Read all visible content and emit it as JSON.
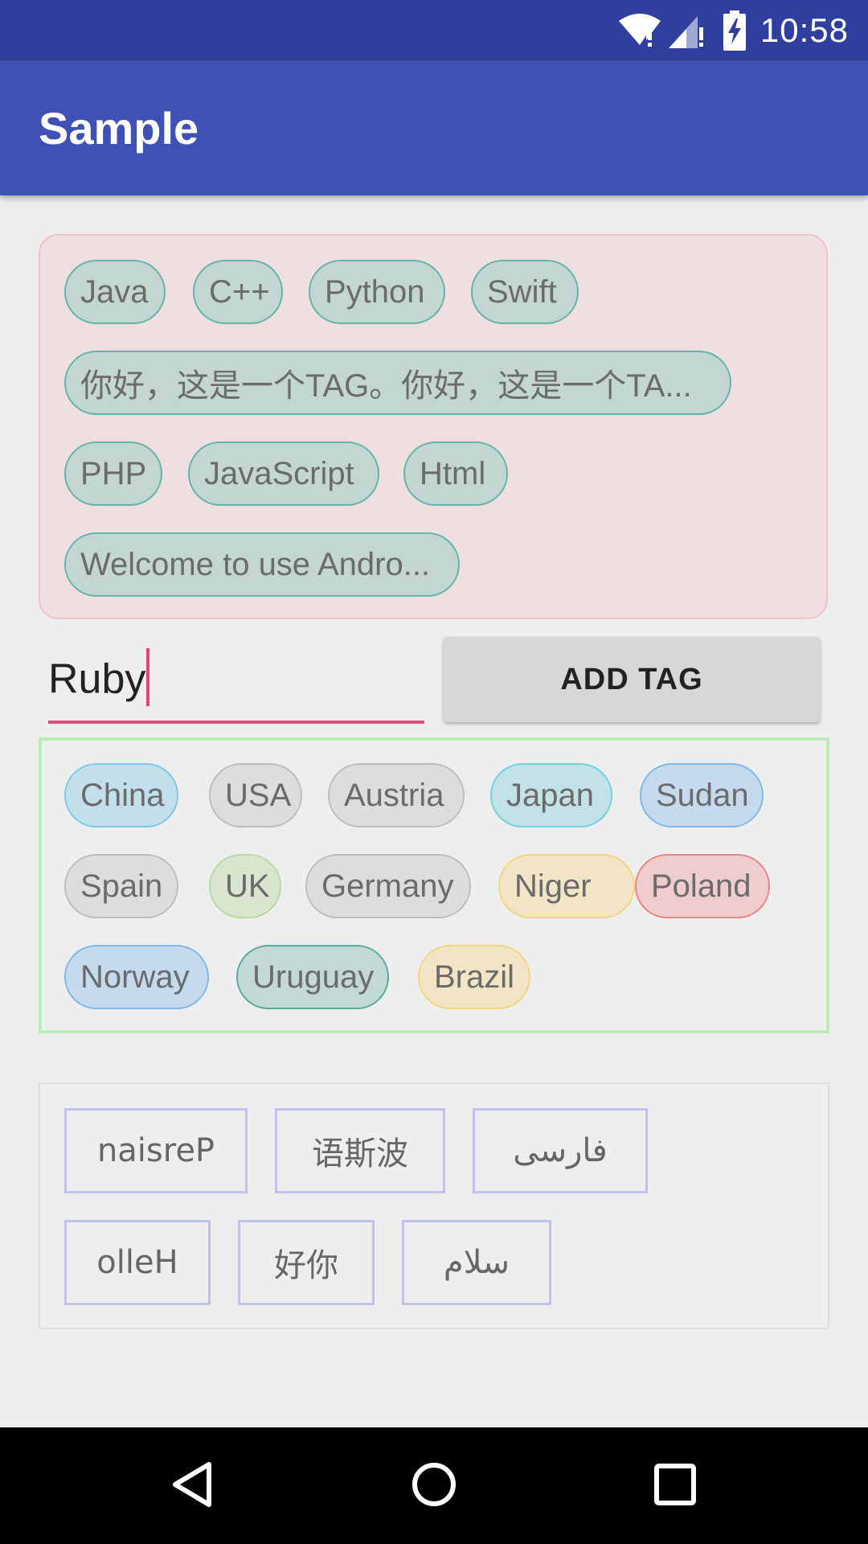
{
  "status_bar": {
    "time": "10:58"
  },
  "app_bar": {
    "title": "Sample"
  },
  "tags_group_1": {
    "tags": [
      "Java",
      "C++",
      "Python",
      "Swift",
      "你好，这是一个TAG。你好，这是一个TA...",
      "PHP",
      "JavaScript",
      "Html",
      "Welcome to use Andro..."
    ]
  },
  "input": {
    "value": "Ruby"
  },
  "add_button": {
    "label": "ADD TAG"
  },
  "tags_group_2": {
    "tags": [
      {
        "label": "China",
        "bg": "#c3dfec",
        "border": "#7ec6ec"
      },
      {
        "label": "USA",
        "bg": "#dddddd",
        "border": "#bdbdbd"
      },
      {
        "label": "Austria",
        "bg": "#dddddd",
        "border": "#bdbdbd"
      },
      {
        "label": "Japan",
        "bg": "#c3e2e7",
        "border": "#6fd2de"
      },
      {
        "label": "Sudan",
        "bg": "#c5daed",
        "border": "#7fb8ec"
      },
      {
        "label": "Spain",
        "bg": "#dddddd",
        "border": "#bdbdbd"
      },
      {
        "label": "UK",
        "bg": "#d9e5cf",
        "border": "#b6dca0"
      },
      {
        "label": "Germany",
        "bg": "#dddddd",
        "border": "#bdbdbd"
      },
      {
        "label": "Niger",
        "bg": "#f1e5c5",
        "border": "#f5d57c"
      },
      {
        "label": "Poland",
        "bg": "#efcccd",
        "border": "#ea8583"
      },
      {
        "label": "Norway",
        "bg": "#c5daed",
        "border": "#7fb8ec"
      },
      {
        "label": "Uruguay",
        "bg": "#c3d9d6",
        "border": "#58ab9e"
      },
      {
        "label": "Brazil",
        "bg": "#f1e5c5",
        "border": "#f5d57c"
      }
    ]
  },
  "tags_group_3": {
    "tags": [
      "naisreP",
      "语斯波",
      "فارسی",
      "olleH",
      "好你",
      "سلام"
    ]
  }
}
